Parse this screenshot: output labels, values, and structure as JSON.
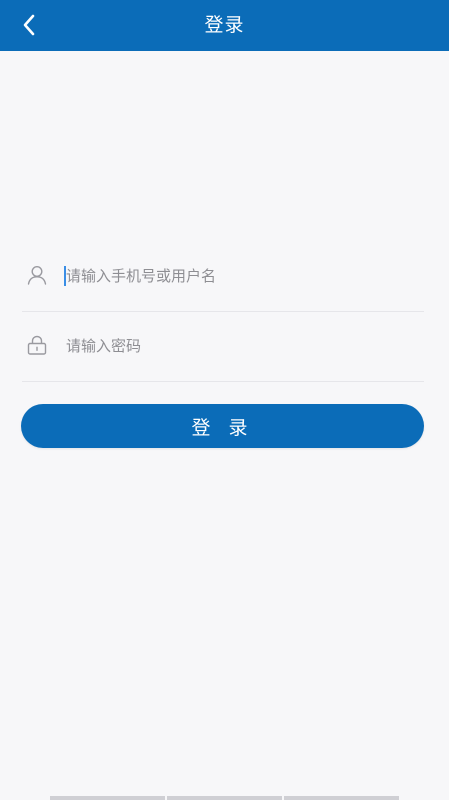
{
  "header": {
    "title": "登录",
    "back_icon": "chevron-left-icon",
    "background_color": "#0b6cb8"
  },
  "form": {
    "username": {
      "icon": "user-icon",
      "placeholder": "请输入手机号或用户名",
      "value": ""
    },
    "password": {
      "icon": "lock-icon",
      "placeholder": "请输入密码",
      "value": ""
    },
    "submit_label": "登 录"
  },
  "colors": {
    "accent": "#0b6cb8",
    "background": "#f7f7f9",
    "placeholder": "#8e8e93"
  }
}
